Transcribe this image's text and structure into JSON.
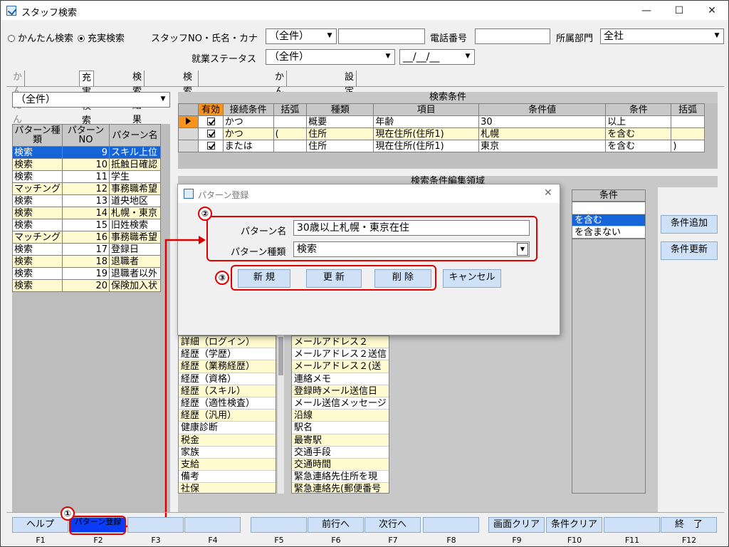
{
  "window": {
    "title": "スタッフ検索"
  },
  "search": {
    "radio_simple": "かんたん検索",
    "radio_full": "充実検索",
    "staff_label": "スタッフNO・氏名・カナ",
    "staff_combo": "（全件）",
    "phone_label": "電話番号",
    "dept_label": "所属部門",
    "dept_value": "全社",
    "status_label": "就業ステータス",
    "status_value": "（全件）",
    "date_value": "__/__/__"
  },
  "tabs": [
    "かんたん検索",
    "充実検索",
    "検索結果",
    "検索結果(顔写真)",
    "かんたん確認",
    "設定"
  ],
  "left": {
    "filter": "（全件）",
    "headers": [
      "パターン種類",
      "パターンNO",
      "パターン名"
    ],
    "rows": [
      {
        "type": "検索",
        "no": "9",
        "name": "スキル上位"
      },
      {
        "type": "検索",
        "no": "10",
        "name": "抵触日確認"
      },
      {
        "type": "検索",
        "no": "11",
        "name": "学生"
      },
      {
        "type": "マッチング",
        "no": "12",
        "name": "事務職希望"
      },
      {
        "type": "検索",
        "no": "13",
        "name": "道央地区"
      },
      {
        "type": "検索",
        "no": "14",
        "name": "札幌・東京"
      },
      {
        "type": "検索",
        "no": "15",
        "name": "旧姓検索"
      },
      {
        "type": "マッチング",
        "no": "16",
        "name": "事務職希望"
      },
      {
        "type": "検索",
        "no": "17",
        "name": "登録日"
      },
      {
        "type": "検索",
        "no": "18",
        "name": "退職者"
      },
      {
        "type": "検索",
        "no": "19",
        "name": "退職者以外"
      },
      {
        "type": "検索",
        "no": "20",
        "name": "保険加入状"
      }
    ]
  },
  "conditions": {
    "title": "検索条件",
    "headers": [
      "有効",
      "接続条件",
      "括弧",
      "種類",
      "項目",
      "条件値",
      "条件",
      "括弧"
    ],
    "rows": [
      {
        "conn": "かつ",
        "open": "",
        "kind": "概要",
        "item": "年齢",
        "value": "30",
        "cond": "以上",
        "close": ""
      },
      {
        "conn": "かつ",
        "open": "(",
        "kind": "住所",
        "item": "現在住所(住所1)",
        "value": "札幌",
        "cond": "を含む",
        "close": ""
      },
      {
        "conn": "または",
        "open": "",
        "kind": "住所",
        "item": "現在住所(住所1)",
        "value": "東京",
        "cond": "を含む",
        "close": ")"
      }
    ]
  },
  "edit": {
    "title": "検索条件編集領域",
    "cond_header": "条件",
    "cond_options": [
      "",
      "を含む",
      "を含まない"
    ],
    "add_button": "条件追加",
    "update_button": "条件更新",
    "list_a": [
      "詳細（ログイン）",
      "経歴（学歴）",
      "経歴（業務経歴）",
      "経歴（資格）",
      "経歴（スキル）",
      "経歴（適性検査）",
      "経歴（汎用）",
      "健康診断",
      "税金",
      "家族",
      "支給",
      "備考",
      "社保"
    ],
    "list_b": [
      "メールアドレス２",
      "メールアドレス２送信",
      "メールアドレス２(送",
      "連絡メモ",
      "登録時メール送信日",
      "メール送信メッセージ",
      "沿線",
      "駅名",
      "最寄駅",
      "交通手段",
      "交通時間",
      "緊急連絡先住所を現",
      "緊急連絡先(郵便番号"
    ]
  },
  "dialog": {
    "title": "パターン登録",
    "name_label": "パターン名",
    "name_value": "30歳以上札幌・東京在住",
    "type_label": "パターン種類",
    "type_value": "検索",
    "new_button": "新 規",
    "update_button": "更 新",
    "delete_button": "削 除",
    "cancel_button": "キャンセル"
  },
  "annotations": [
    "①",
    "②",
    "③"
  ],
  "fkeys": [
    {
      "label": "ヘルプ",
      "key": "F1"
    },
    {
      "label": "パターン登録",
      "key": "F2"
    },
    {
      "label": "",
      "key": "F3"
    },
    {
      "label": "",
      "key": "F4"
    },
    {
      "label": "",
      "key": "F5"
    },
    {
      "label": "前行へ",
      "key": "F6"
    },
    {
      "label": "次行へ",
      "key": "F7"
    },
    {
      "label": "",
      "key": "F8"
    },
    {
      "label": "画面クリア",
      "key": "F9"
    },
    {
      "label": "条件クリア",
      "key": "F10"
    },
    {
      "label": "",
      "key": "F11"
    },
    {
      "label": "終　了",
      "key": "F12"
    }
  ],
  "colors": {
    "selection": "#1565d8",
    "highlight_row": "#fffad0",
    "annotation": "#e00000",
    "button": "#cfe1f7"
  }
}
